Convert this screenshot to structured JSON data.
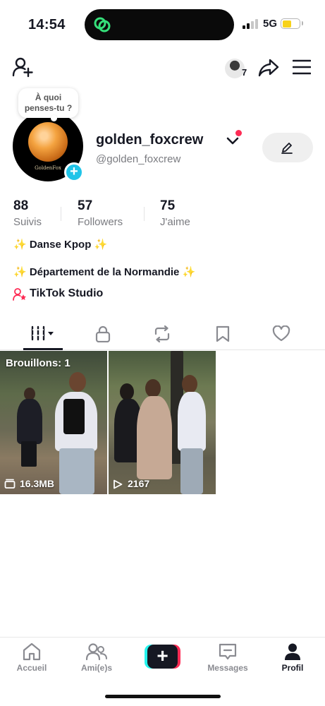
{
  "status_bar": {
    "time": "14:54",
    "network": "5G",
    "battery_level": 0.55,
    "battery_color": "#f7d21a"
  },
  "top_nav": {
    "story_count": "7",
    "icons": [
      "add-friend-icon",
      "share-icon",
      "menu-icon"
    ]
  },
  "profile": {
    "thought_bubble": "À quoi penses-tu ?",
    "avatar_text": "GoldenFox",
    "username": "golden_foxcrew",
    "handle": "@golden_foxcrew"
  },
  "stats": [
    {
      "value": "88",
      "label": "Suivis"
    },
    {
      "value": "57",
      "label": "Followers"
    },
    {
      "value": "75",
      "label": "J'aime"
    }
  ],
  "bio": {
    "line1": "✨ Danse Kpop ✨",
    "line2": "✨ Département de la Normandie ✨",
    "studio": "TikTok Studio"
  },
  "tabs": [
    {
      "icon": "grid-icon",
      "active": true
    },
    {
      "icon": "lock-icon",
      "active": false
    },
    {
      "icon": "repost-icon",
      "active": false
    },
    {
      "icon": "bookmark-icon",
      "active": false
    },
    {
      "icon": "heart-icon",
      "active": false
    }
  ],
  "videos": [
    {
      "overlay_title": "Brouillons: 1",
      "stat": "16.3MB",
      "stat_icon": "drafts-icon"
    },
    {
      "overlay_title": "",
      "stat": "2167",
      "stat_icon": "play-icon"
    }
  ],
  "bottom_nav": [
    {
      "label": "Accueil",
      "icon": "home-icon",
      "active": false
    },
    {
      "label": "Ami(e)s",
      "icon": "friends-icon",
      "active": false
    },
    {
      "label": "",
      "icon": "plus-icon",
      "active": false
    },
    {
      "label": "Messages",
      "icon": "inbox-icon",
      "active": false
    },
    {
      "label": "Profil",
      "icon": "profile-icon",
      "active": true
    }
  ],
  "colors": {
    "accent_red": "#fe2c55",
    "accent_cyan": "#25f4ee",
    "plus_badge": "#20c4e8"
  }
}
